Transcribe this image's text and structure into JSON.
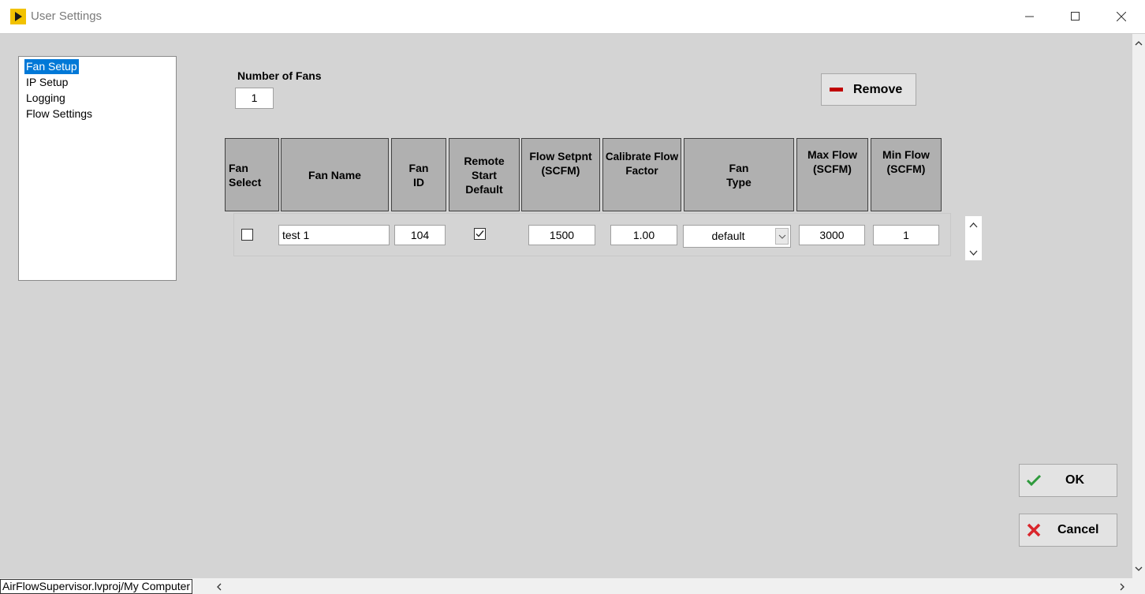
{
  "window": {
    "title": "User Settings"
  },
  "sidebar": {
    "items": [
      {
        "label": "Fan Setup",
        "selected": true
      },
      {
        "label": "IP Setup"
      },
      {
        "label": "Logging"
      },
      {
        "label": "Flow Settings"
      }
    ]
  },
  "fan_setup": {
    "number_of_fans_label": "Number of Fans",
    "number_of_fans_value": "1",
    "remove_label": "Remove"
  },
  "table": {
    "headers": [
      "Fan\nSelect",
      "Fan Name",
      "Fan\nID",
      "Remote\nStart\nDefault",
      "Flow Setpnt\n(SCFM)",
      "Calibrate Flow\nFactor",
      "Fan\nType",
      "Max Flow\n(SCFM)",
      "Min Flow\n(SCFM)"
    ],
    "row": {
      "fan_select": false,
      "fan_name": "test 1",
      "fan_id": "104",
      "remote_start_default": true,
      "flow_setpoint": "1500",
      "calibrate_flow_factor": "1.00",
      "fan_type": "default",
      "max_flow": "3000",
      "min_flow": "1"
    }
  },
  "buttons": {
    "ok_label": "OK",
    "cancel_label": "Cancel"
  },
  "status": {
    "path": "AirFlowSupervisor.lvproj/My Computer"
  },
  "colors": {
    "selection": "#0078d7",
    "header_bg": "#b0b0b0",
    "remove_icon": "#c00000",
    "ok_icon": "#2e9a3c",
    "cancel_icon": "#d9262c"
  }
}
